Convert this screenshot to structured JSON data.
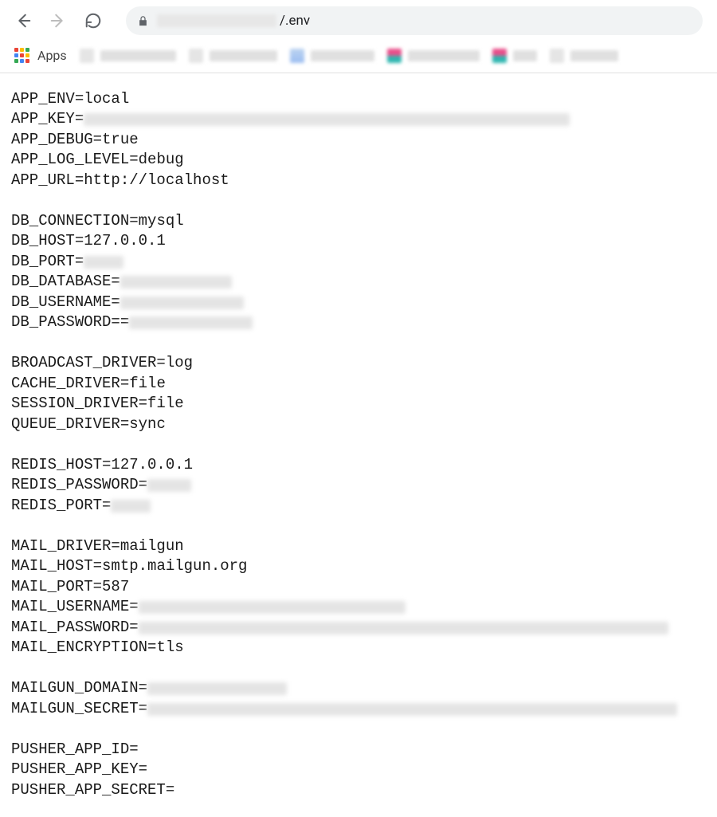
{
  "browser": {
    "url_visible_suffix": "/.env"
  },
  "bookmarks": {
    "apps_label": "Apps"
  },
  "env": {
    "lines": [
      {
        "key": "APP_ENV",
        "value": "local"
      },
      {
        "key": "APP_KEY",
        "redacted_width": 610
      },
      {
        "key": "APP_DEBUG",
        "value": "true"
      },
      {
        "key": "APP_LOG_LEVEL",
        "value": "debug"
      },
      {
        "key": "APP_URL",
        "value": "http://localhost"
      },
      {
        "spacer": true
      },
      {
        "key": "DB_CONNECTION",
        "value": "mysql"
      },
      {
        "key": "DB_HOST",
        "value": "127.0.0.1"
      },
      {
        "key": "DB_PORT",
        "redacted_width": 50
      },
      {
        "key": "DB_DATABASE",
        "redacted_width": 140
      },
      {
        "key": "DB_USERNAME",
        "redacted_width": 155
      },
      {
        "key": "DB_PASSWORD",
        "value": "=",
        "redacted_width": 155
      },
      {
        "spacer": true
      },
      {
        "key": "BROADCAST_DRIVER",
        "value": "log"
      },
      {
        "key": "CACHE_DRIVER",
        "value": "file"
      },
      {
        "key": "SESSION_DRIVER",
        "value": "file"
      },
      {
        "key": "QUEUE_DRIVER",
        "value": "sync"
      },
      {
        "spacer": true
      },
      {
        "key": "REDIS_HOST",
        "value": "127.0.0.1"
      },
      {
        "key": "REDIS_PASSWORD",
        "redacted_width": 55
      },
      {
        "key": "REDIS_PORT",
        "redacted_width": 50
      },
      {
        "spacer": true
      },
      {
        "key": "MAIL_DRIVER",
        "value": "mailgun"
      },
      {
        "key": "MAIL_HOST",
        "value": "smtp.mailgun.org"
      },
      {
        "key": "MAIL_PORT",
        "value": "587"
      },
      {
        "key": "MAIL_USERNAME",
        "redacted_width": 335
      },
      {
        "key": "MAIL_PASSWORD",
        "redacted_width": 665
      },
      {
        "key": "MAIL_ENCRYPTION",
        "value": "tls"
      },
      {
        "spacer": true
      },
      {
        "key": "MAILGUN_DOMAIN",
        "redacted_width": 175
      },
      {
        "key": "MAILGUN_SECRET",
        "redacted_width": 665
      },
      {
        "spacer": true
      },
      {
        "key": "PUSHER_APP_ID",
        "value": ""
      },
      {
        "key": "PUSHER_APP_KEY",
        "value": ""
      },
      {
        "key": "PUSHER_APP_SECRET",
        "value": ""
      }
    ]
  }
}
